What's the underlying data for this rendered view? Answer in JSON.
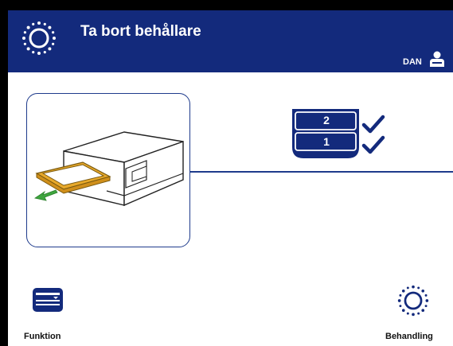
{
  "header": {
    "title": "Ta bort behållare",
    "user": "DAN",
    "icons": [
      "processing-sun-icon",
      "user-icon"
    ]
  },
  "main": {
    "tray_illustration": "remove-tray-illustration",
    "container_stack": {
      "slots": [
        {
          "label": "2",
          "status": "checked"
        },
        {
          "label": "1",
          "status": "checked"
        }
      ]
    }
  },
  "footer": {
    "function_label": "Funktion",
    "processing_label": "Behandling"
  },
  "colors": {
    "primary": "#132a7c",
    "accent_yellow": "#e8a92a",
    "arrow_green": "#3ea53e",
    "background": "#ffffff"
  }
}
